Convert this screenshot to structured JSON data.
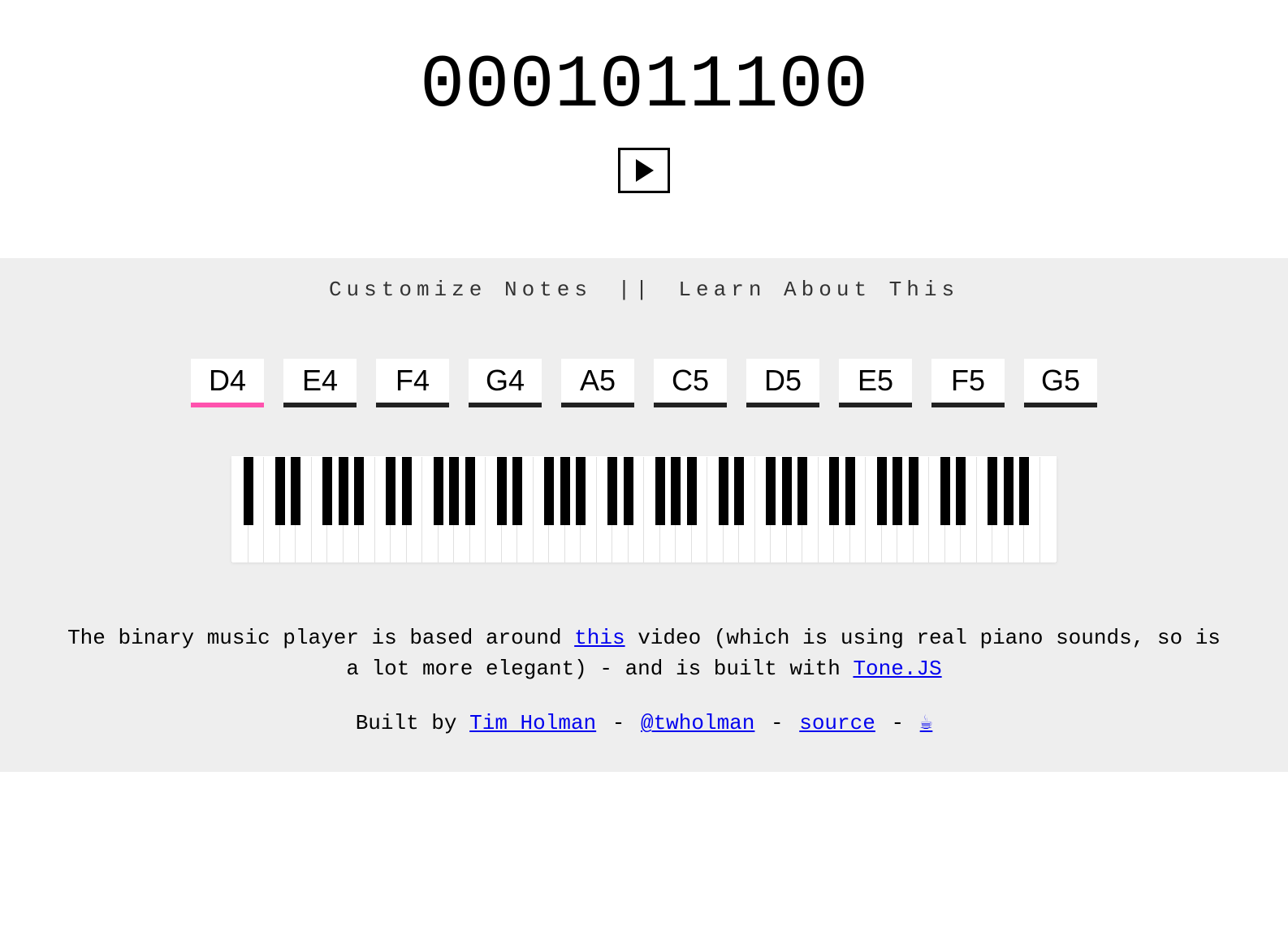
{
  "binary": "0001011100",
  "nav": {
    "customize": "Customize Notes",
    "sep": "||",
    "learn": "Learn About This"
  },
  "notes": [
    "D4",
    "E4",
    "F4",
    "G4",
    "A5",
    "C5",
    "D5",
    "E5",
    "F5",
    "G5"
  ],
  "selectedNote": 0,
  "piano": {
    "octaves": 7,
    "extraWhite": 3
  },
  "description": {
    "pre_link1": "The binary music player is based around ",
    "link1": "this",
    "post_link1": " video (which is using real piano sounds, so is a lot more elegant) - and is built with ",
    "link2": "Tone.JS"
  },
  "credit": {
    "built_by": "Built by ",
    "author": "Tim Holman",
    "sep": " - ",
    "handle": "@twholman",
    "source": "source",
    "coffee": "☕"
  }
}
